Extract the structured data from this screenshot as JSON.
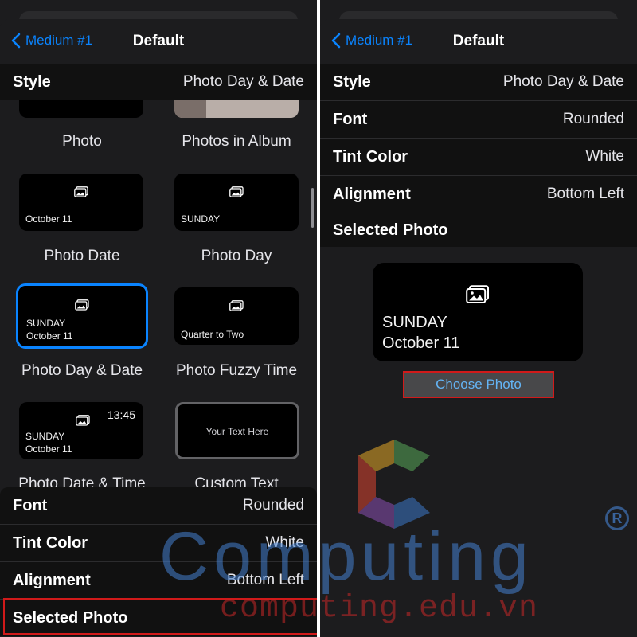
{
  "left": {
    "nav": {
      "back_label": "Medium #1",
      "title": "Default"
    },
    "style_row": {
      "label": "Style",
      "value": "Photo Day & Date"
    },
    "gallery": {
      "tiles": [
        {
          "caption": "Photo"
        },
        {
          "caption": "Photos in Album"
        },
        {
          "caption": "Photo Date",
          "line1": "October 11"
        },
        {
          "caption": "Photo Day",
          "line1": "SUNDAY"
        },
        {
          "caption": "Photo Day & Date",
          "line1": "SUNDAY",
          "line2": "October 11"
        },
        {
          "caption": "Photo Fuzzy Time",
          "line1": "Quarter to Two"
        },
        {
          "caption": "Photo Date & Time",
          "line1": "SUNDAY",
          "line2": "October 11",
          "time": "13:45"
        },
        {
          "caption": "Custom Text",
          "line1": "Your Text Here"
        }
      ]
    },
    "settings": [
      {
        "label": "Font",
        "value": "Rounded"
      },
      {
        "label": "Tint Color",
        "value": "White"
      },
      {
        "label": "Alignment",
        "value": "Bottom Left"
      },
      {
        "label": "Selected Photo",
        "value": ""
      }
    ]
  },
  "right": {
    "nav": {
      "back_label": "Medium #1",
      "title": "Default"
    },
    "settings": [
      {
        "label": "Style",
        "value": "Photo Day & Date"
      },
      {
        "label": "Font",
        "value": "Rounded"
      },
      {
        "label": "Tint Color",
        "value": "White"
      },
      {
        "label": "Alignment",
        "value": "Bottom Left"
      },
      {
        "label": "Selected Photo",
        "value": ""
      }
    ],
    "preview": {
      "line1": "SUNDAY",
      "line2": "October 11"
    },
    "choose_photo_label": "Choose Photo"
  },
  "watermark": {
    "brand": "Computing",
    "url": "computing.edu.vn",
    "registered": "R"
  },
  "colors": {
    "accent": "#0a84ff",
    "highlight": "#d11a1a",
    "background": "#1c1c1e"
  }
}
